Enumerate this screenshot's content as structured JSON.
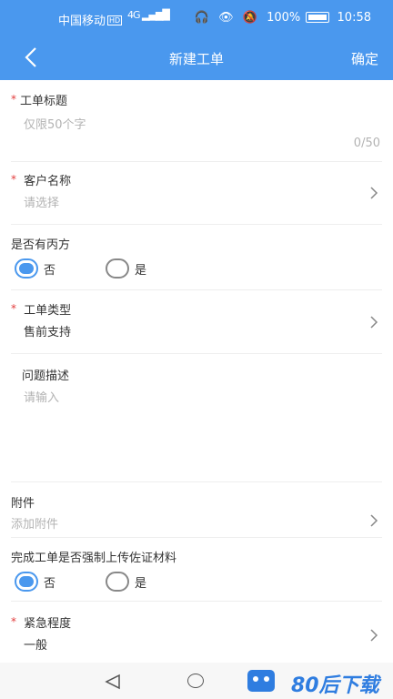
{
  "status_bar": {
    "carrier": "中国移动",
    "hd_badge": "HD",
    "signal": "4G",
    "battery": "100%",
    "time": "10:58"
  },
  "header": {
    "title": "新建工单",
    "confirm_label": "确定"
  },
  "form": {
    "ticket_title": {
      "label": "工单标题",
      "placeholder": "仅限50个字",
      "counter": "0/50"
    },
    "customer": {
      "label": "客户名称",
      "placeholder": "请选择"
    },
    "third_party": {
      "label": "是否有丙方",
      "options": [
        "否",
        "是"
      ],
      "selected": "否"
    },
    "ticket_type": {
      "label": "工单类型",
      "value": "售前支持"
    },
    "description": {
      "label": "问题描述",
      "placeholder": "请输入"
    },
    "attachment": {
      "label": "附件",
      "placeholder": "添加附件"
    },
    "force_upload": {
      "label": "完成工单是否强制上传佐证材料",
      "options": [
        "否",
        "是"
      ],
      "selected": "否"
    },
    "urgency": {
      "label": "紧急程度",
      "value": "一般"
    }
  },
  "required_mark": "*",
  "watermark": {
    "text": "80后下载"
  },
  "colors": {
    "primary": "#4a98ee",
    "required": "#e23c3c",
    "placeholder": "#b3b3b3"
  },
  "icons": [
    "back-arrow-icon",
    "chevron-right-icon",
    "nav-back-icon",
    "nav-home-icon"
  ]
}
